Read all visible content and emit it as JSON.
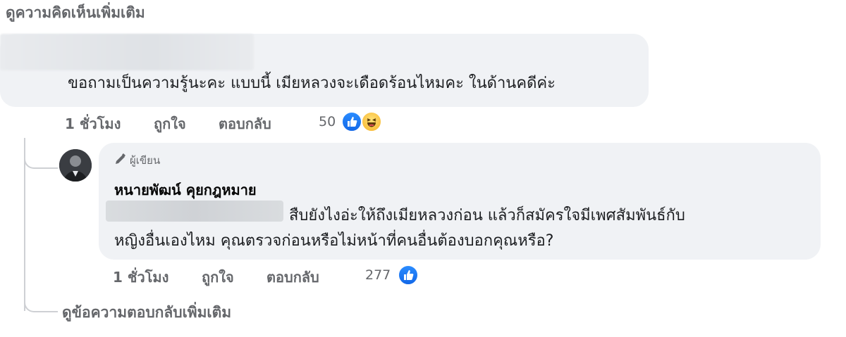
{
  "header": {
    "view_more_comments": "ดูความคิดเห็นเพิ่มเติม"
  },
  "comment": {
    "text": "ขอถามเป็นความรู้นะคะ แบบนี้ เมียหลวงจะเดือดร้อนไหมคะ ในด้านคดีค่ะ",
    "time": "1 ชั่วโมง",
    "like_label": "ถูกใจ",
    "reply_label": "ตอบกลับ",
    "reaction_count": "50",
    "reactions": [
      "like-icon",
      "haha-icon"
    ]
  },
  "reply": {
    "badge": "ผู้เขียน",
    "author": "หนายพัฒน์ คุยกฎหมาย",
    "text_line1": "สืบยังไงอ่ะให้ถึงเมียหลวงก่อน แล้วก็สมัครใจมีเพศสัมพันธ์กับ",
    "text_line2": "หญิงอื่นเองไหม คุณตรวจก่อนหรือไม่หน้าที่คนอื่นต้องบอกคุณหรือ?",
    "time": "1 ชั่วโมง",
    "like_label": "ถูกใจ",
    "reply_label": "ตอบกลับ",
    "reaction_count": "277",
    "reactions": [
      "like-icon"
    ]
  },
  "footer": {
    "view_more_replies": "ดูข้อความตอบกลับเพิ่มเติม"
  },
  "colors": {
    "bubble": "#f0f2f5",
    "meta": "#65676b",
    "like": "#1877f2"
  }
}
